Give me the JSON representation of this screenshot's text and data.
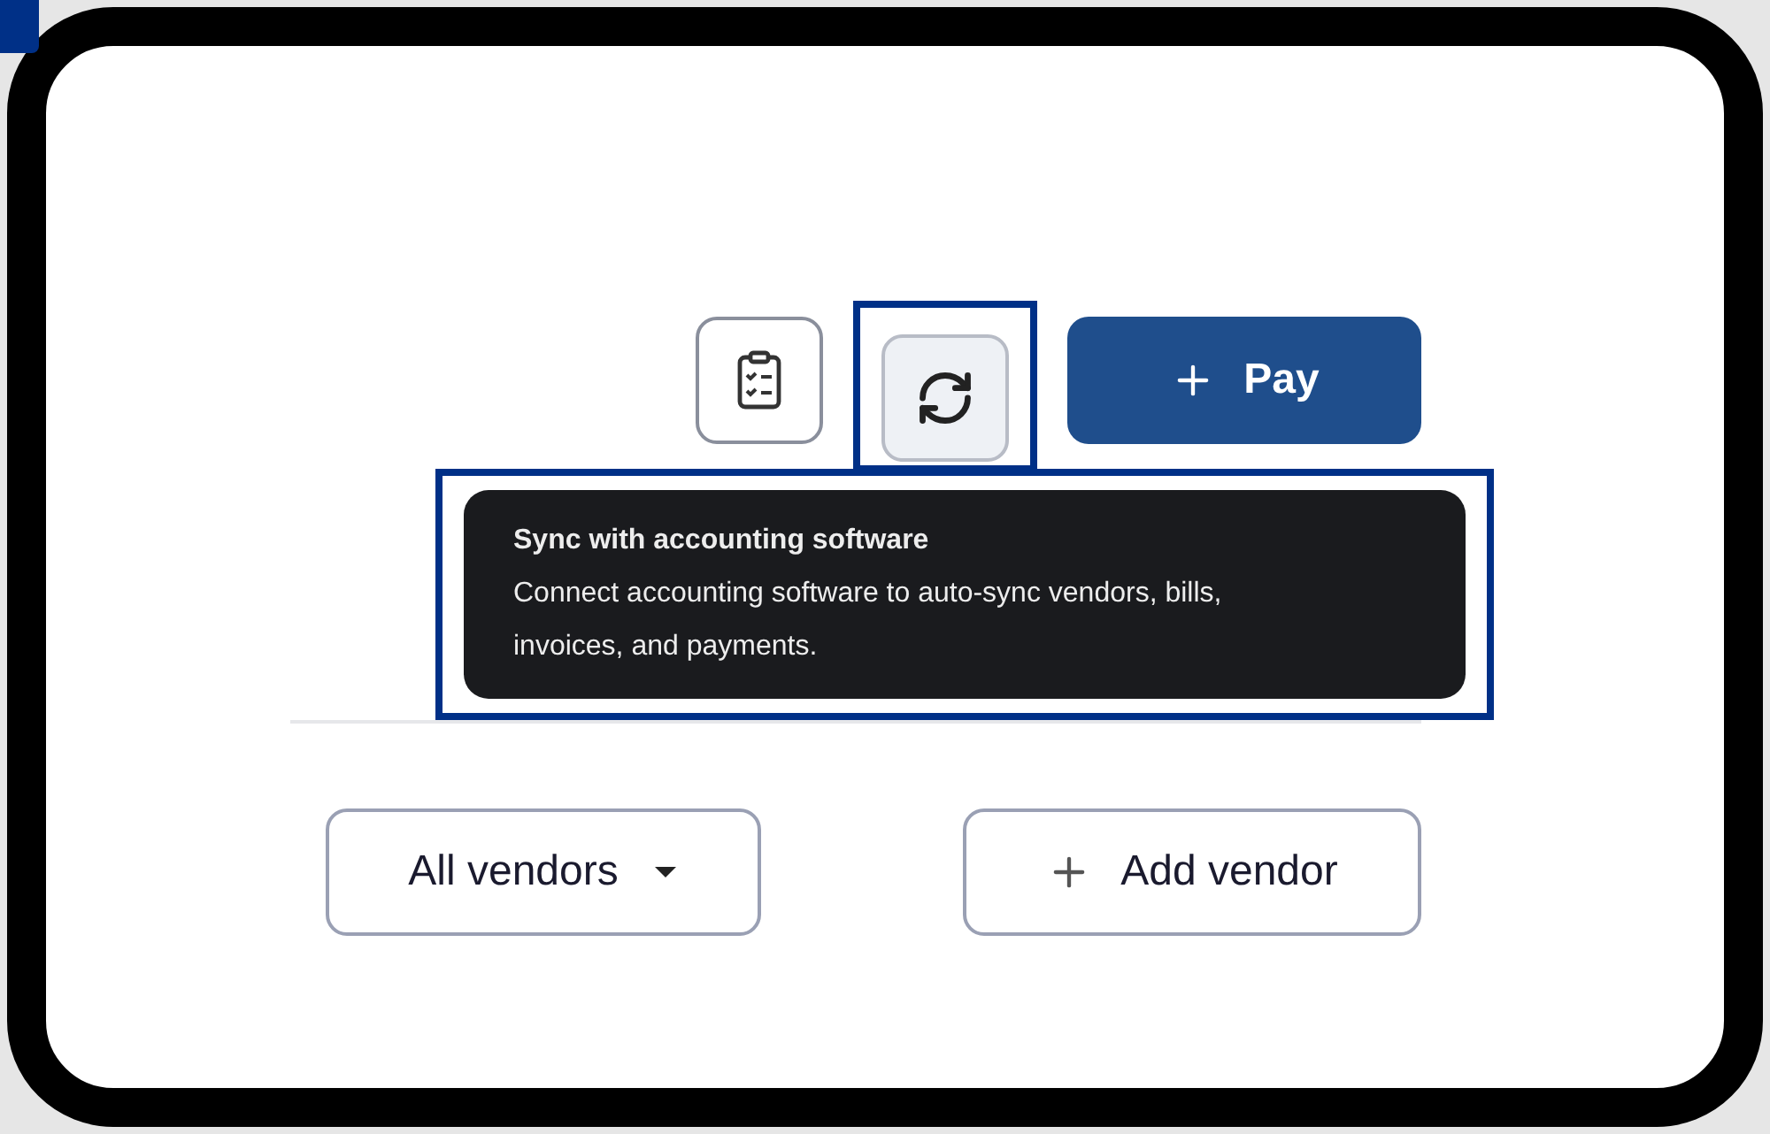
{
  "toolbar": [
    {
      "kind": "checklist",
      "highlighted": false
    },
    {
      "kind": "sync",
      "highlighted": true
    },
    {
      "kind": "primary",
      "label": "Pay",
      "highlighted": false
    }
  ],
  "tooltip": {
    "title": "Sync with accounting software",
    "text": "Connect accounting software to auto-sync vendors, bills, invoices, and payments.",
    "highlighted": true
  },
  "filters": {
    "dropdown": "All vendors",
    "add_button": "Add vendor"
  }
}
